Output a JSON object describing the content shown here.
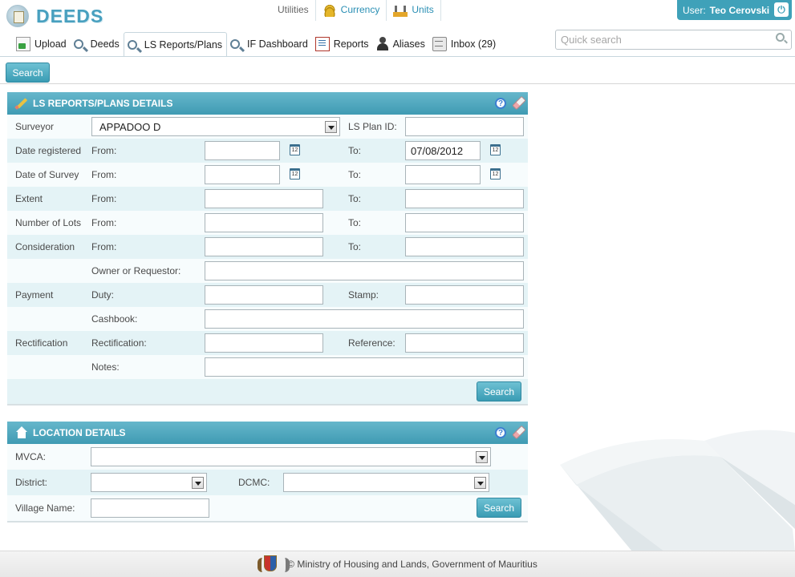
{
  "app": {
    "name": "DEEDS"
  },
  "utilities": {
    "label": "Utilities",
    "currency": "Currency",
    "units": "Units"
  },
  "user": {
    "prefix": "User:",
    "name": "Teo Cerovski"
  },
  "nav": {
    "upload": "Upload",
    "deeds": "Deeds",
    "ls_reports": "LS Reports/Plans",
    "if_dashboard": "IF Dashboard",
    "reports": "Reports",
    "aliases": "Aliases",
    "inbox": "Inbox (29)"
  },
  "quick_search": {
    "placeholder": "Quick search",
    "value": ""
  },
  "toolbar": {
    "search": "Search"
  },
  "ls_panel": {
    "title": "LS REPORTS/PLANS DETAILS",
    "surveyor_label": "Surveyor",
    "surveyor_value": "APPADOO D",
    "plan_id_label": "LS Plan ID:",
    "plan_id_value": "",
    "date_registered": "Date registered",
    "date_of_survey": "Date of Survey",
    "extent": "Extent",
    "number_of_lots": "Number of Lots",
    "consideration": "Consideration",
    "from": "From:",
    "to": "To:",
    "date_registered_to_value": "07/08/2012",
    "owner_label": "Owner or Requestor:",
    "payment": "Payment",
    "duty": "Duty:",
    "stamp": "Stamp:",
    "cashbook": "Cashbook:",
    "rectification": "Rectification",
    "rectification_field": "Rectification:",
    "reference": "Reference:",
    "notes": "Notes:",
    "calendar_glyph": "12",
    "search": "Search"
  },
  "location_panel": {
    "title": "LOCATION DETAILS",
    "mvca": "MVCA:",
    "district": "District:",
    "dcmc": "DCMC:",
    "village": "Village Name:",
    "search": "Search"
  },
  "footer": {
    "text": "© Ministry of Housing and Lands, Government of Mauritius"
  },
  "colors": {
    "accent": "#3fa1b9",
    "header_text": "#48a0bf",
    "row_alt": "#e4f3f6"
  },
  "icons": [
    "logo-icon",
    "coins-icon",
    "ruler-icon",
    "power-icon",
    "upload-icon",
    "search-icon",
    "reports-icon",
    "person-icon",
    "inbox-icon",
    "pencil-icon",
    "house-icon",
    "help-icon",
    "eraser-icon",
    "calendar-icon",
    "crest-icon"
  ]
}
